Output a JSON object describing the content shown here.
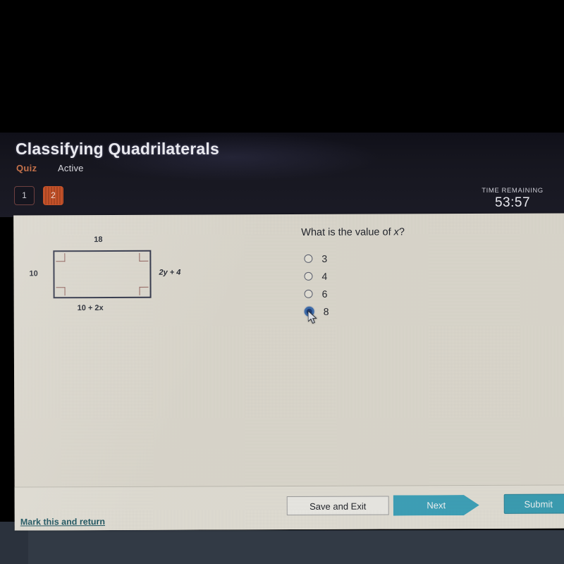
{
  "header": {
    "title": "Classifying Quadrilaterals",
    "kind": "Quiz",
    "status": "Active",
    "question_tabs": [
      {
        "label": "1",
        "state": "idle"
      },
      {
        "label": "2",
        "state": "active"
      }
    ],
    "timer_label": "TIME REMAINING",
    "timer_value": "53:57"
  },
  "figure": {
    "shape": "rectangle",
    "top_label": "18",
    "left_label": "10",
    "right_label": "2y + 4",
    "bottom_label": "10 + 2x",
    "right_angle_marks": 4
  },
  "question": {
    "text_before": "What is the value of ",
    "variable": "x",
    "text_after": "?",
    "options": [
      {
        "label": "3",
        "selected": false
      },
      {
        "label": "4",
        "selected": false
      },
      {
        "label": "6",
        "selected": false
      },
      {
        "label": "8",
        "selected": true
      }
    ]
  },
  "footer": {
    "mark_link": "Mark this and return",
    "save_button": "Save and Exit",
    "next_button": "Next",
    "submit_button": "Submit"
  },
  "colors": {
    "accent_teal": "#3fa3ba",
    "active_tab": "#c4522a",
    "quiz_label": "#c4714a",
    "link": "#1d5560",
    "selected_radio": "#1f3f7a",
    "figure_stroke": "#2c3145",
    "angle_mark": "#8d5a55",
    "card_bg": "#dedacf",
    "header_bg": "#16161f"
  }
}
